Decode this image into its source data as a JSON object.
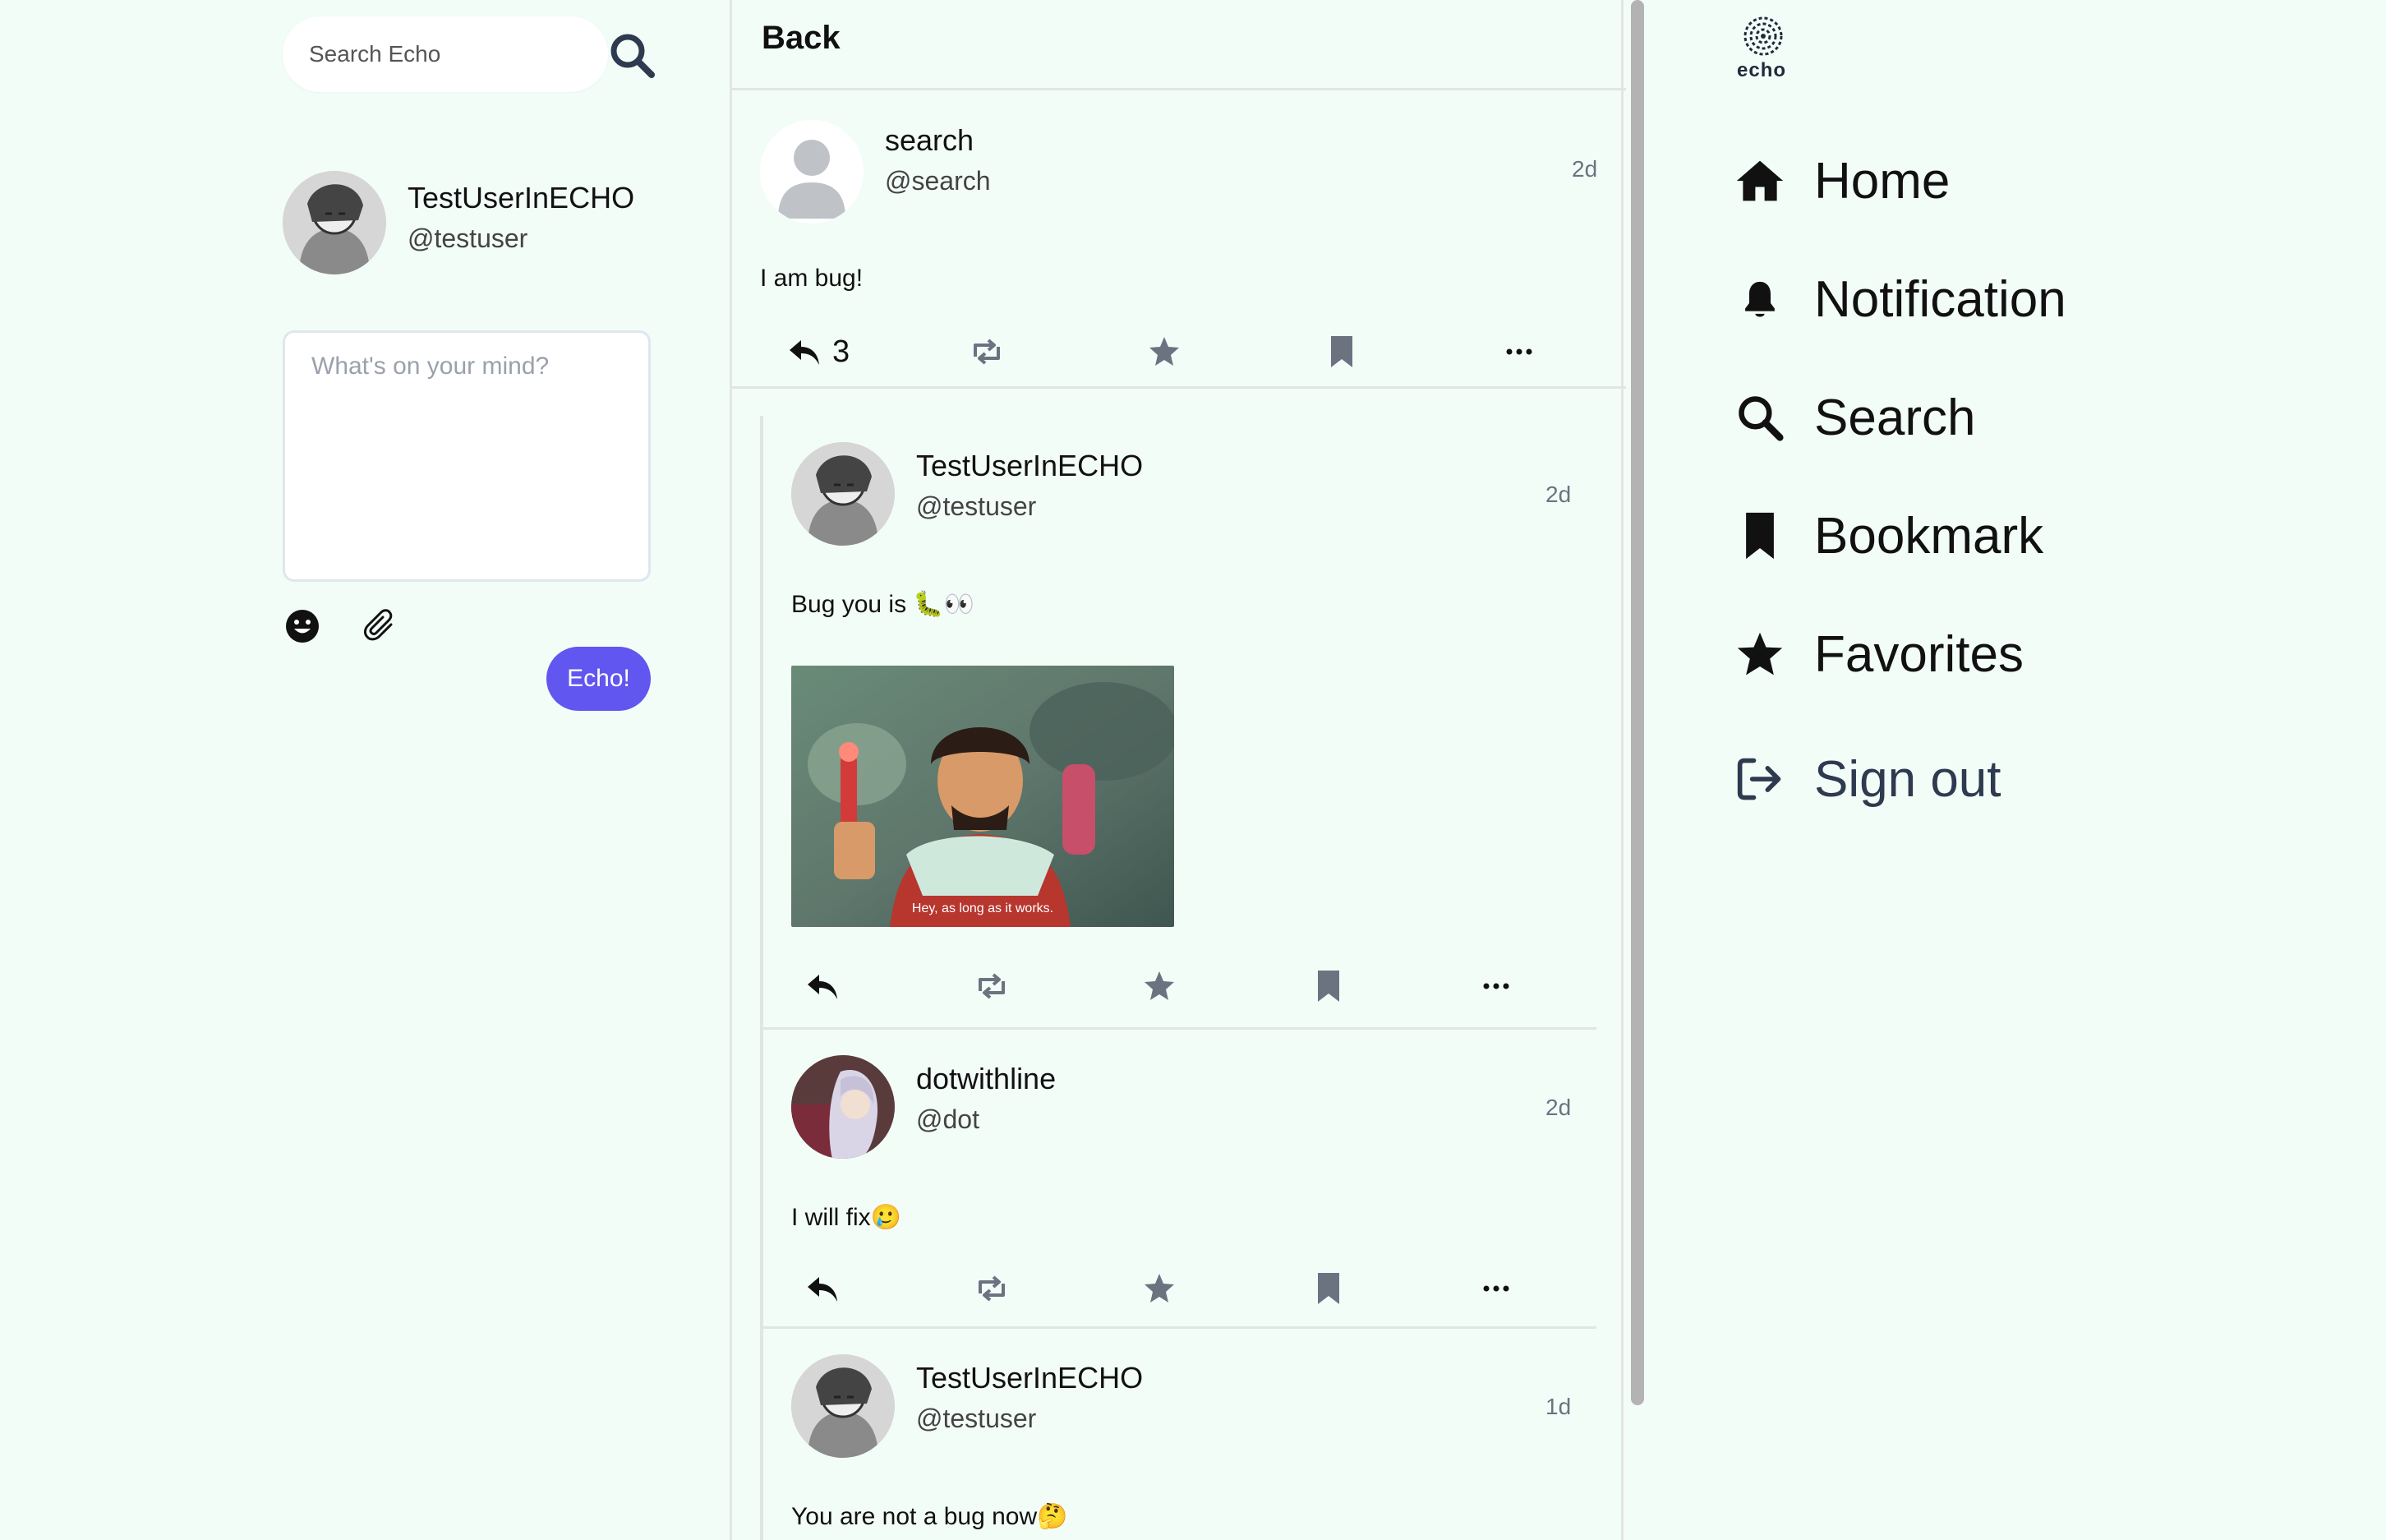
{
  "search": {
    "placeholder": "Search Echo"
  },
  "current_user": {
    "name": "TestUserInECHO",
    "handle": "@testuser"
  },
  "compose": {
    "placeholder": "What's on your mind?",
    "submit_label": "Echo!"
  },
  "header": {
    "back_label": "Back"
  },
  "main_post": {
    "name": "search",
    "handle": "@search",
    "time": "2d",
    "text": "I am bug!",
    "reply_count": "3"
  },
  "replies": [
    {
      "name": "TestUserInECHO",
      "handle": "@testuser",
      "time": "2d",
      "text": "Bug you is 🐛👀",
      "media_caption": "Hey, as long as it works."
    },
    {
      "name": "dotwithline",
      "handle": "@dot",
      "time": "2d",
      "text": "I will fix🥲"
    },
    {
      "name": "TestUserInECHO",
      "handle": "@testuser",
      "time": "1d",
      "text": "You are not a bug now🤔"
    }
  ],
  "brand": {
    "name": "echo"
  },
  "nav": {
    "home": "Home",
    "notification": "Notification",
    "search": "Search",
    "bookmark": "Bookmark",
    "favorites": "Favorites",
    "signout": "Sign out"
  },
  "colors": {
    "background": "#f3fdf8",
    "accent": "#6156f0",
    "icon_gray": "#6b7381"
  }
}
